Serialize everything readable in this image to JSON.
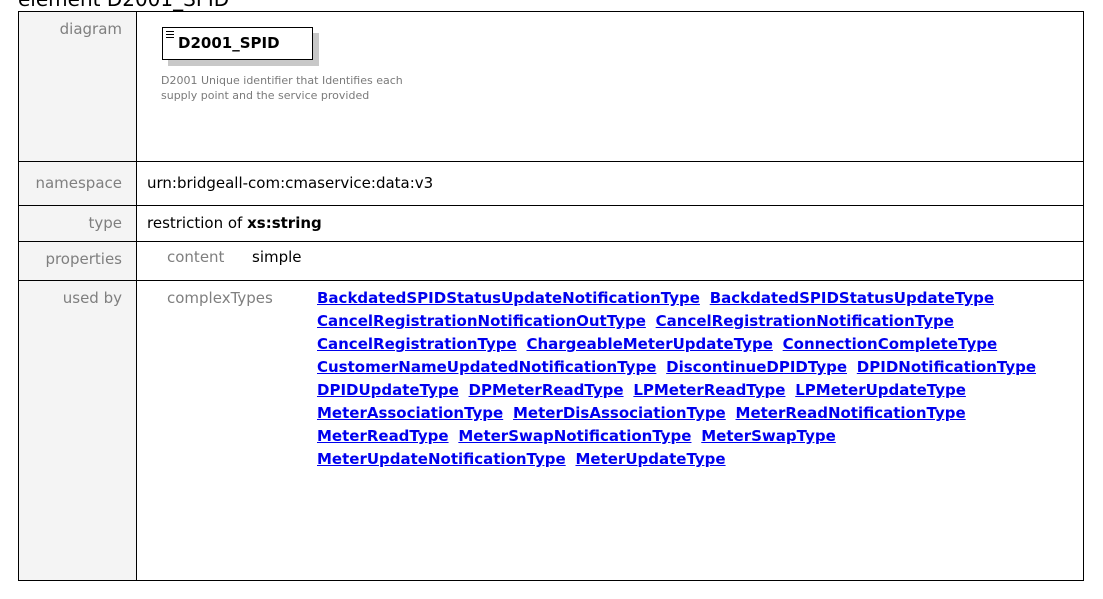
{
  "heading": "element D2001_SPID",
  "rows": {
    "diagram": {
      "label": "diagram",
      "node_name": "D2001_SPID",
      "documentation": "D2001 Unique identifier that Identifies each supply point and the service provided"
    },
    "namespace": {
      "label": "namespace",
      "value": "urn:bridgeall-com:cmaservice:data:v3"
    },
    "type": {
      "label": "type",
      "prefix": "restriction of",
      "base": "xs:string"
    },
    "properties": {
      "label": "properties",
      "content_label": "content",
      "content_value": "simple"
    },
    "used_by": {
      "label": "used by",
      "group_label": "complexTypes",
      "links": [
        "BackdatedSPIDStatusUpdateNotificationType",
        "BackdatedSPIDStatusUpdateType",
        "CancelRegistrationNotificationOutType",
        "CancelRegistrationNotificationType",
        "CancelRegistrationType",
        "ChargeableMeterUpdateType",
        "ConnectionCompleteType",
        "CustomerNameUpdatedNotificationType",
        "DiscontinueDPIDType",
        "DPIDNotificationType",
        "DPIDUpdateType",
        "DPMeterReadType",
        "LPMeterReadType",
        "LPMeterUpdateType",
        "MeterAssociationType",
        "MeterDisAssociationType",
        "MeterReadNotificationType",
        "MeterReadType",
        "MeterSwapNotificationType",
        "MeterSwapType",
        "MeterUpdateNotificationType",
        "MeterUpdateType"
      ]
    }
  }
}
